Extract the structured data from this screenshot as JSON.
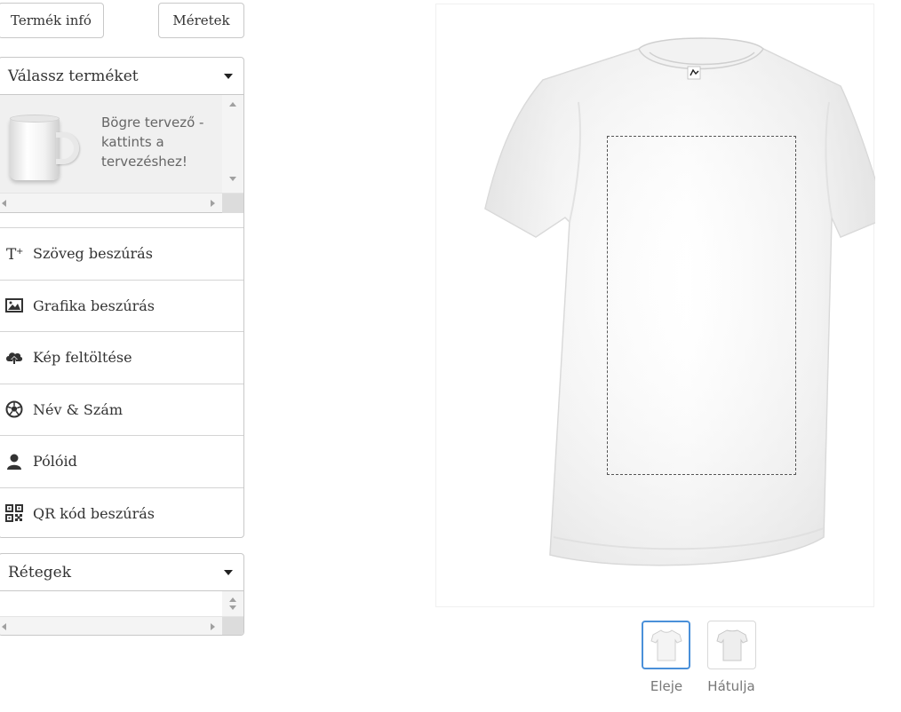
{
  "top_buttons": {
    "product_info": "Termék infó",
    "sizes": "Méretek"
  },
  "product_panel": {
    "header": "Válassz terméket",
    "product": {
      "name": "Bögre tervező - kattints a tervezéshez!",
      "icon": "mug-icon"
    }
  },
  "tools": [
    {
      "label": "Szöveg beszúrás",
      "icon": "text-insert-icon"
    },
    {
      "label": "Grafika beszúrás",
      "icon": "image-icon"
    },
    {
      "label": "Kép feltöltése",
      "icon": "cloud-upload-icon"
    },
    {
      "label": "Név & Szám",
      "icon": "soccer-ball-icon"
    },
    {
      "label": "Pólóid",
      "icon": "user-icon"
    },
    {
      "label": "QR kód beszúrás",
      "icon": "qr-code-icon"
    }
  ],
  "layers_panel": {
    "header": "Rétegek"
  },
  "views": [
    {
      "label": "Eleje",
      "selected": true
    },
    {
      "label": "Hátulja",
      "selected": false
    }
  ],
  "colors": {
    "accent": "#4a90d9",
    "border": "#c8c8c8",
    "shirt": "#ffffff"
  }
}
